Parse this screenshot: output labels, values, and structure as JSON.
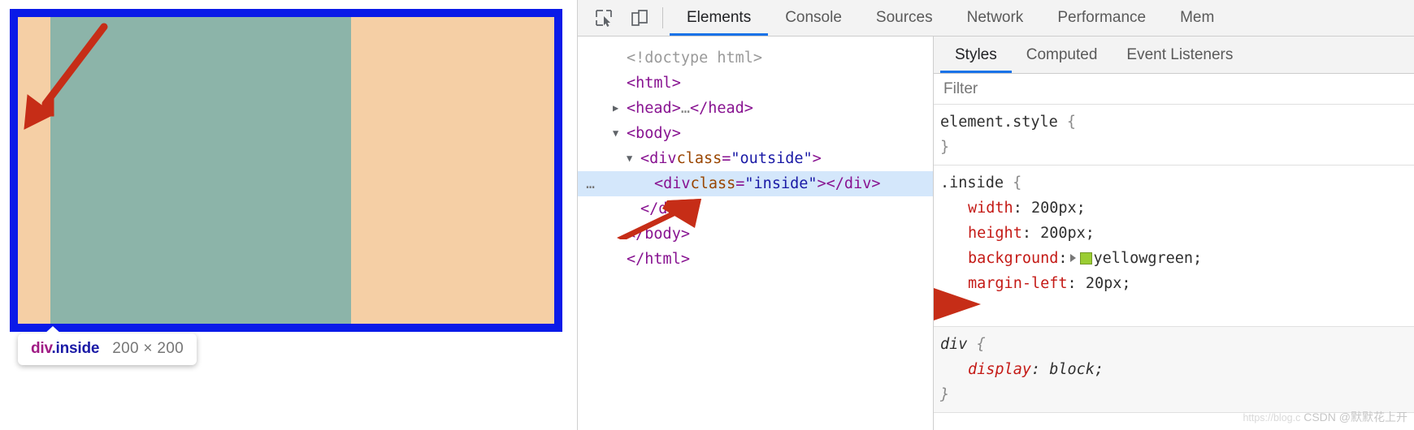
{
  "viewport": {
    "outside_box": {
      "name": "div.outside",
      "background_color": "#f5cfa5"
    },
    "inside_box": {
      "name": "div.inside",
      "background_color": "#8cb4a9"
    },
    "border_color": "#0a1ae8",
    "annotation_arrow_color": "#c62d17"
  },
  "tooltip": {
    "tag_name": "div",
    "class_name": ".inside",
    "dimensions": "200 × 200"
  },
  "devtools": {
    "toolbar": {
      "inspect_icon": "inspect-element-icon",
      "device_icon": "device-toolbar-icon",
      "tabs": [
        {
          "label": "Elements",
          "active": true
        },
        {
          "label": "Console",
          "active": false
        },
        {
          "label": "Sources",
          "active": false
        },
        {
          "label": "Network",
          "active": false
        },
        {
          "label": "Performance",
          "active": false
        },
        {
          "label": "Mem",
          "active": false
        }
      ]
    },
    "dom_tree": [
      {
        "indent": 1,
        "twisty": "",
        "gutter": "",
        "selected": false,
        "parts": [
          {
            "cls": "tok-doctype",
            "text": "<!doctype html>"
          }
        ]
      },
      {
        "indent": 1,
        "twisty": "",
        "gutter": "",
        "selected": false,
        "parts": [
          {
            "cls": "tok-tag",
            "text": "<html>"
          }
        ]
      },
      {
        "indent": 1,
        "twisty": "▶",
        "gutter": "",
        "selected": false,
        "parts": [
          {
            "cls": "tok-tag",
            "text": "<head>"
          },
          {
            "cls": "tok-gray",
            "text": "…"
          },
          {
            "cls": "tok-tag",
            "text": "</head>"
          }
        ]
      },
      {
        "indent": 1,
        "twisty": "▼",
        "gutter": "",
        "selected": false,
        "parts": [
          {
            "cls": "tok-tag",
            "text": "<body>"
          }
        ]
      },
      {
        "indent": 2,
        "twisty": "▼",
        "gutter": "",
        "selected": false,
        "parts": [
          {
            "cls": "tok-tag",
            "text": "<div "
          },
          {
            "cls": "tok-attr",
            "text": "class"
          },
          {
            "cls": "tok-tag",
            "text": "="
          },
          {
            "cls": "tok-val",
            "text": "\"outside\""
          },
          {
            "cls": "tok-tag",
            "text": ">"
          }
        ]
      },
      {
        "indent": 3,
        "twisty": "",
        "gutter": "…",
        "selected": true,
        "parts": [
          {
            "cls": "tok-tag",
            "text": "<div "
          },
          {
            "cls": "tok-attr",
            "text": "class"
          },
          {
            "cls": "tok-tag",
            "text": "="
          },
          {
            "cls": "tok-val",
            "text": "\"inside\""
          },
          {
            "cls": "tok-tag",
            "text": "></div>"
          }
        ]
      },
      {
        "indent": 2,
        "twisty": "",
        "gutter": "",
        "selected": false,
        "parts": [
          {
            "cls": "tok-tag",
            "text": "</div>"
          }
        ]
      },
      {
        "indent": 1,
        "twisty": "",
        "gutter": "",
        "selected": false,
        "parts": [
          {
            "cls": "tok-tag",
            "text": "</body>"
          }
        ]
      },
      {
        "indent": 1,
        "twisty": "",
        "gutter": "",
        "selected": false,
        "parts": [
          {
            "cls": "tok-tag",
            "text": "</html>"
          }
        ]
      }
    ],
    "styles": {
      "tabs": [
        {
          "label": "Styles",
          "active": true
        },
        {
          "label": "Computed",
          "active": false
        },
        {
          "label": "Event Listeners",
          "active": false
        }
      ],
      "filter_placeholder": "Filter",
      "filter_value": "",
      "rules": [
        {
          "selector": "element.style",
          "inherited": false,
          "declarations": []
        },
        {
          "selector": ".inside",
          "inherited": false,
          "declarations": [
            {
              "property": "width",
              "value": "200px",
              "swatch": null
            },
            {
              "property": "height",
              "value": "200px",
              "swatch": null
            },
            {
              "property": "background",
              "value": "yellowgreen",
              "swatch": "#9acd32"
            },
            {
              "property": "margin-left",
              "value": "20px",
              "swatch": null
            }
          ]
        },
        {
          "selector": "div",
          "inherited": true,
          "declarations": [
            {
              "property": "display",
              "value": "block",
              "swatch": null
            }
          ]
        }
      ]
    },
    "watermark": {
      "url": "https://blog.c",
      "text": "CSDN @默默花上开"
    }
  }
}
